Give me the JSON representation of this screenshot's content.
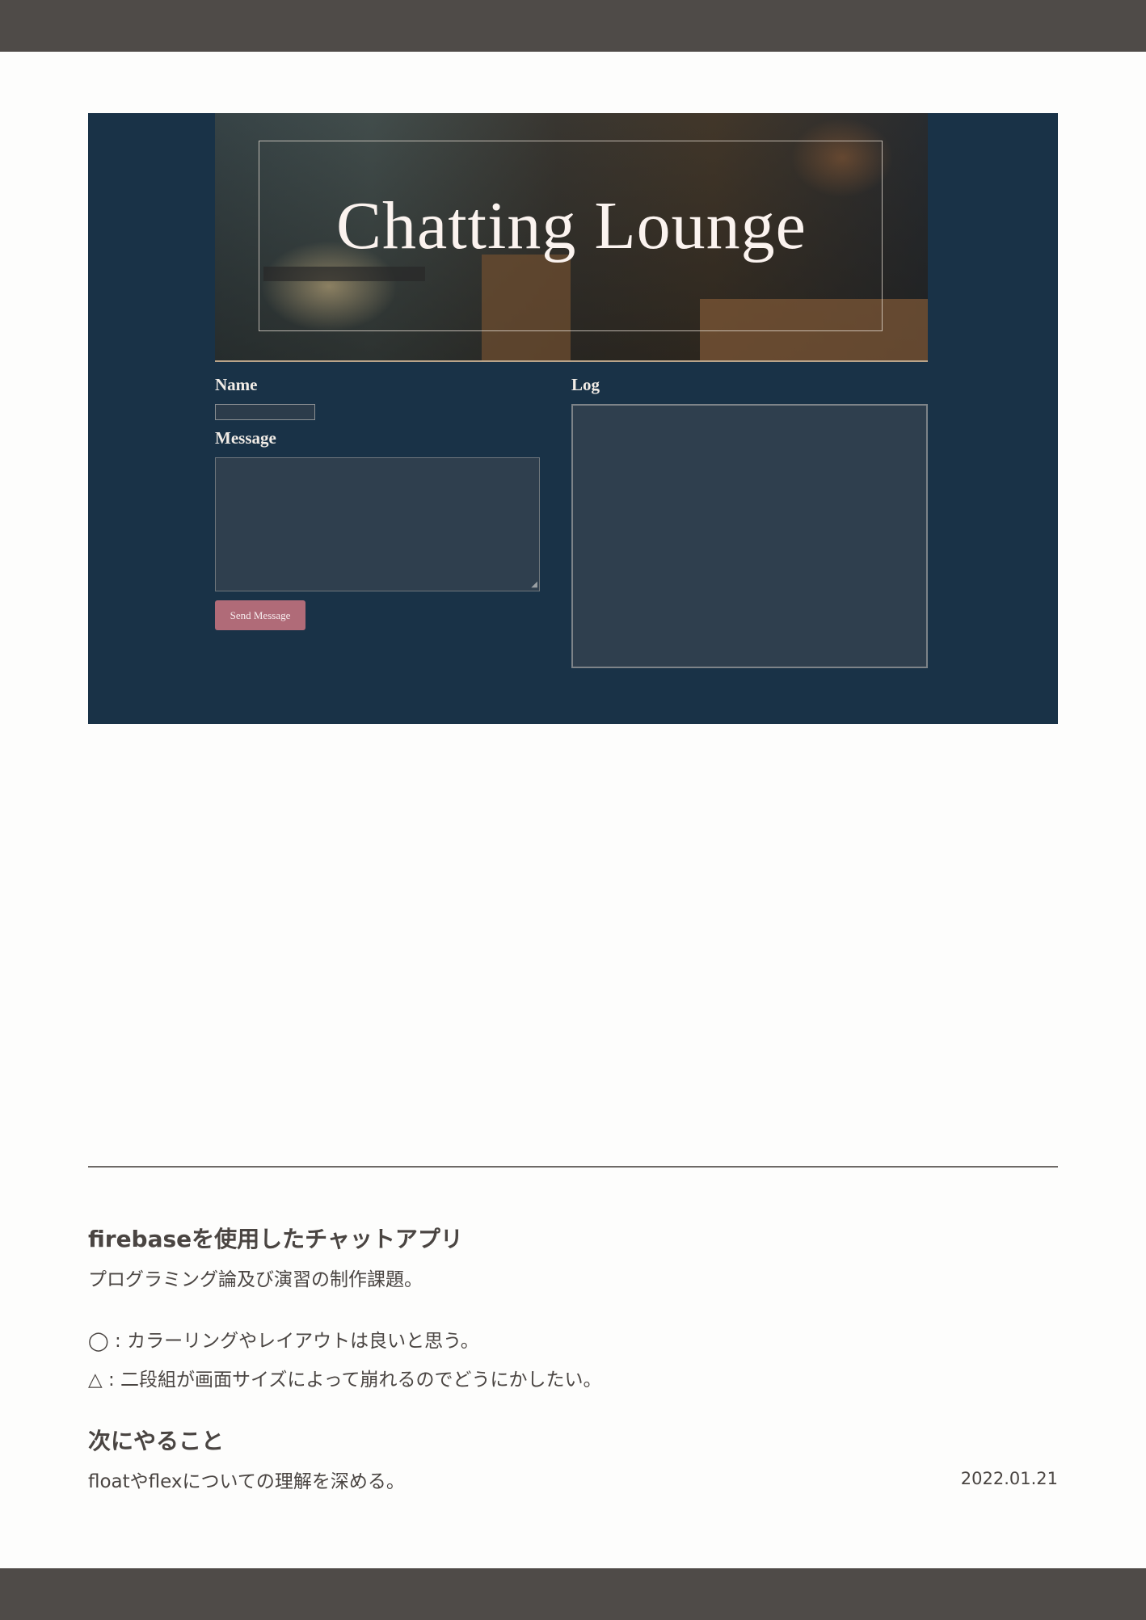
{
  "screenshot": {
    "hero_title": "Chatting Lounge",
    "name_label": "Name",
    "message_label": "Message",
    "send_button": "Send Message",
    "log_label": "Log"
  },
  "description": {
    "heading": "firebaseを使用したチャットアプリ",
    "subtitle": "プログラミング論及び演習の制作課題。",
    "good_point": "◯ : カラーリングやレイアウトは良いと思う。",
    "issue_point": "△ : 二段組が画面サイズによって崩れるのでどうにかしたい。",
    "next_heading": "次にやること",
    "next_text": "floatやflexについての理解を深める。",
    "date": "2022.01.21"
  },
  "colors": {
    "top_bar": "#4f4b48",
    "page_bg": "#fdfdfc",
    "app_bg": "#193247",
    "button": "#b06b78"
  }
}
